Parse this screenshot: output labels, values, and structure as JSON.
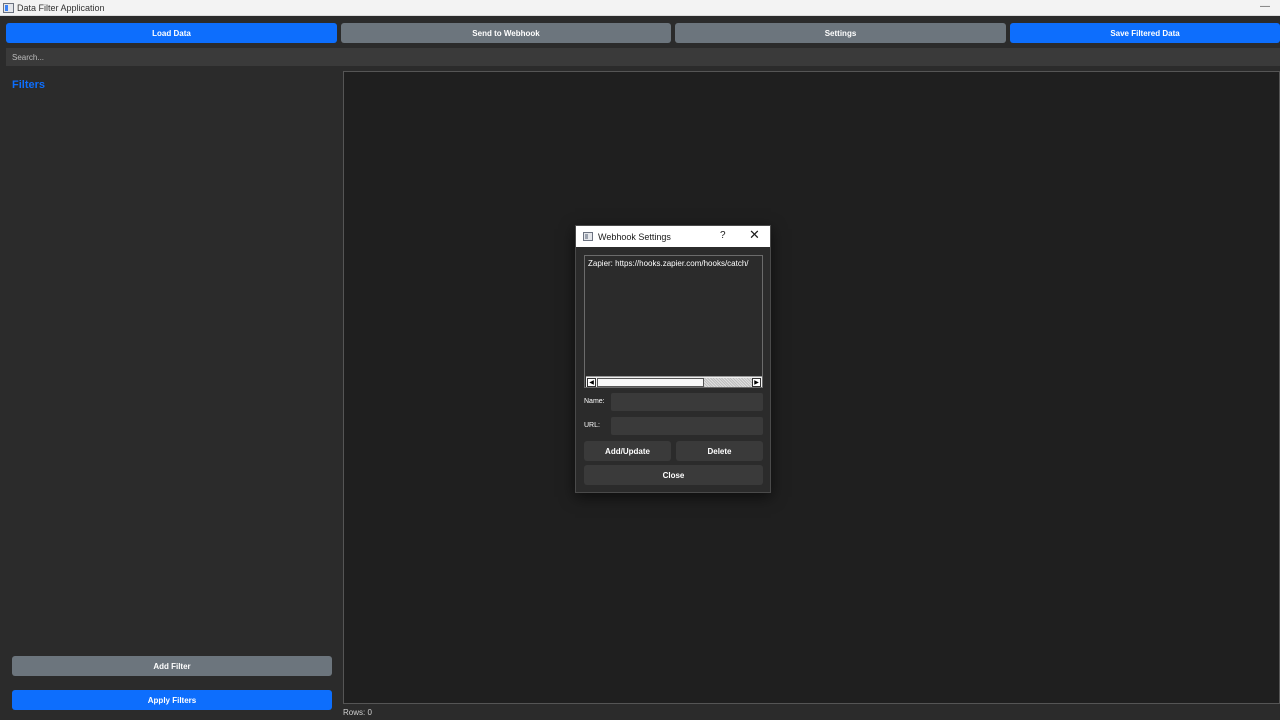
{
  "window": {
    "title": "Data Filter Application",
    "minimize_glyph": "—"
  },
  "toolbar": {
    "load_label": "Load Data",
    "webhook_label": "Send to Webhook",
    "settings_label": "Settings",
    "save_label": "Save Filtered Data"
  },
  "search": {
    "placeholder": "Search..."
  },
  "sidebar": {
    "title": "Filters",
    "add_filter_label": "Add Filter",
    "apply_filters_label": "Apply Filters"
  },
  "status": {
    "rows_text": "Rows: 0"
  },
  "dialog": {
    "title": "Webhook Settings",
    "help_glyph": "?",
    "close_glyph": "✕",
    "list_items": [
      "Zapier: https://hooks.zapier.com/hooks/catch/"
    ],
    "name_label": "Name:",
    "url_label": "URL:",
    "add_update_label": "Add/Update",
    "delete_label": "Delete",
    "close_label": "Close"
  },
  "colors": {
    "accent_blue": "#0d6efd",
    "secondary_gray": "#6c757d",
    "background": "#2b2b2b",
    "data_area": "#1f1f1f"
  }
}
